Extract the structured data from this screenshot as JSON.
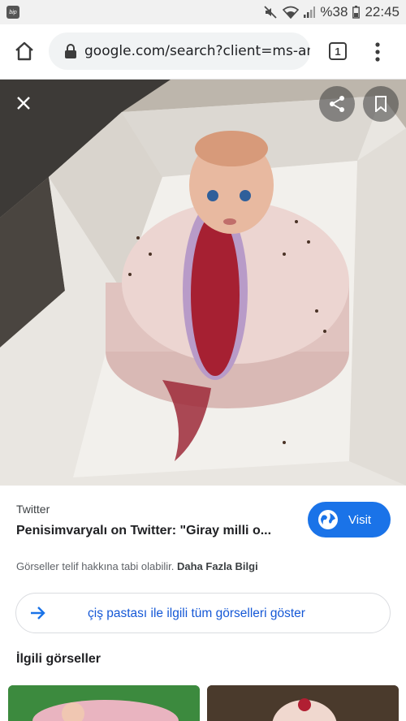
{
  "status_bar": {
    "app_badge": "bip",
    "battery": "%38",
    "time": "22:45"
  },
  "browser": {
    "url": "google.com/search?client=ms-andr",
    "tab_count": "1",
    "icons": [
      "home-icon",
      "lock-icon",
      "tabs-icon",
      "menu-icon"
    ]
  },
  "viewer": {
    "icons": [
      "close-icon",
      "share-icon",
      "bookmark-icon"
    ]
  },
  "result": {
    "source": "Twitter",
    "title": "Penisimvaryalı on Twitter: \"Giray milli o...",
    "visit_label": "Visit",
    "copyright_text": "Görseller telif hakkına tabi olabilir.",
    "more_info": "Daha Fazla Bilgi"
  },
  "all_images_label": "çiş pastası ile ilgili tüm görselleri göster",
  "related_title": "İlgili görseller",
  "colors": {
    "accent": "#1a73e8",
    "link": "#1558d6"
  }
}
